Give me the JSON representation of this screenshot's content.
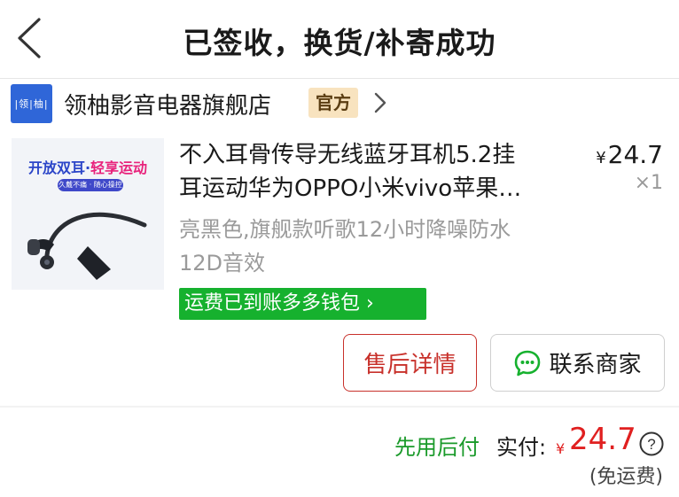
{
  "header": {
    "title": "已签收，换货/补寄成功",
    "back_icon": "chevron-left-icon"
  },
  "store": {
    "logo_text": "|领|柚|",
    "name": "领柚影音电器旗舰店",
    "badge": "官方",
    "arrow_icon": "chevron-right-icon"
  },
  "product": {
    "image_title_a": "开放双耳·",
    "image_title_b": "轻享运动",
    "image_pill": "久戴不痛 · 随心操控",
    "title_line1": "不入耳骨传导无线蓝牙耳机5.2挂",
    "title_line2": "耳运动华为OPPO小米vivo苹果…",
    "price_symbol": "¥",
    "price": "24.7",
    "quantity": "×1",
    "spec_line1": "亮黑色,旗舰款听歌12小时降噪防水",
    "spec_line2": "12D音效",
    "shipping_badge": "运费已到账多多钱包 ›"
  },
  "actions": {
    "after_sale": "售后详情",
    "contact": "联系商家",
    "contact_icon": "chat-icon"
  },
  "payment": {
    "method": "先用后付",
    "actual_label": "实付:",
    "symbol": "¥",
    "amount": "24.7",
    "help_icon": "help-icon",
    "free_shipping": "(免运费)"
  },
  "colors": {
    "accent_red": "#e02020",
    "green": "#16b12e",
    "store_blue": "#2f66d8",
    "badge_bg": "#f8e3bf"
  }
}
